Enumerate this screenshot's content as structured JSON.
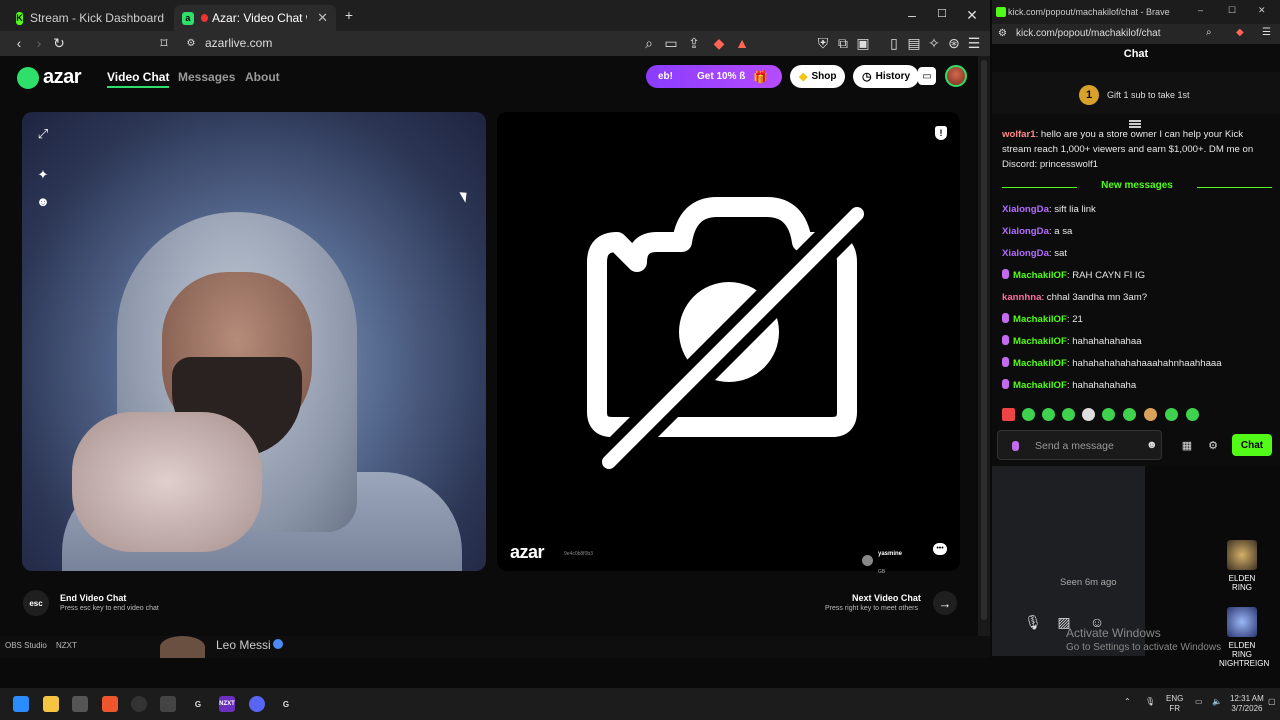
{
  "browser": {
    "tabs": [
      {
        "title": "Stream - Kick Dashboard",
        "favicon": "kick-icon"
      },
      {
        "title": "Azar: Video Chat with New Pe",
        "favicon": "azar-icon"
      }
    ],
    "url": "azarlive.com"
  },
  "azar": {
    "logo_text": "azar",
    "nav": [
      "Video Chat",
      "Messages",
      "About"
    ],
    "promo_left": "eb!",
    "promo_right": "Get 10% ß",
    "shop_label": "Shop",
    "history_label": "History",
    "watermark": "azar",
    "watermark_id": "9e4c0b8f0b3",
    "peer_name": "yasmine",
    "peer_country": "GB",
    "end_title": "End Video Chat",
    "end_sub": "Press esc key to end video chat",
    "esc_label": "esc",
    "next_title": "Next Video Chat",
    "next_sub": "Press right key to meet others"
  },
  "kick": {
    "window_title": "kick.com/popout/machakilof/chat - Brave",
    "url": "kick.com/popout/machakilof/chat",
    "chat_title": "Chat",
    "gift_badge": "1",
    "gift_text": "Gift 1 sub to take 1st",
    "first_msg_user": "wolfar1",
    "first_msg_text": ": hello are you a store owner I can help your Kick stream reach 1,000+ viewers and earn $1,000+. DM me on Discord: princesswolf1",
    "new_messages": "New messages",
    "messages": [
      {
        "user": "XialongDa",
        "text": ": sift lia link",
        "color": "#b36cff",
        "mic": false
      },
      {
        "user": "XialongDa",
        "text": ": a sa",
        "color": "#b36cff",
        "mic": false
      },
      {
        "user": "XialongDa",
        "text": ": sat",
        "color": "#b36cff",
        "mic": false
      },
      {
        "user": "MachakilOF",
        "text": ": RAH CAYN FI IG",
        "color": "#53fc18",
        "mic": true
      },
      {
        "user": "kannhna",
        "text": ": chhal 3andha mn 3am?",
        "color": "#ff6b9b",
        "mic": false
      },
      {
        "user": "MachakilOF",
        "text": ": 21",
        "color": "#53fc18",
        "mic": true
      },
      {
        "user": "MachakilOF",
        "text": ": hahahahahahaa",
        "color": "#53fc18",
        "mic": true
      },
      {
        "user": "MachakilOF",
        "text": ": hahahahahahahaaahahnhaahhaaa",
        "color": "#53fc18",
        "mic": true
      },
      {
        "user": "MachakilOF",
        "text": ": hahahahahaha",
        "color": "#53fc18",
        "mic": true
      }
    ],
    "input_placeholder": "Send a message",
    "send_label": "Chat"
  },
  "desktop": {
    "seen": "Seen 6m ago",
    "activate_1": "Activate Windows",
    "activate_2": "Go to Settings to activate Windows",
    "icons": [
      "ELDEN RING",
      "ELDEN RING NIGHTREIGN"
    ],
    "below_labels": [
      "OBS Studio",
      "NZXT"
    ],
    "leo": "Leo Messi"
  },
  "taskbar": {
    "lang_1": "ENG",
    "lang_2": "FR",
    "time": "12:31 AM",
    "date": "3/7/2026"
  }
}
